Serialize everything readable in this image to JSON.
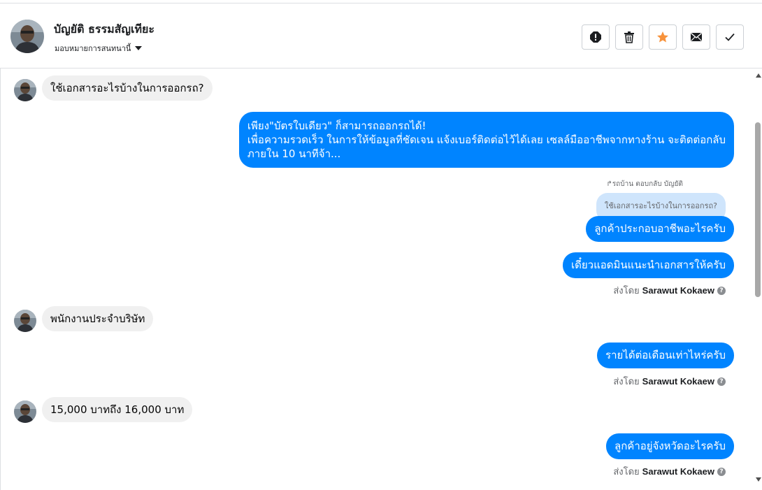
{
  "header": {
    "customer_name": "บัญยัติ ธรรมสัญเทียะ",
    "assign_label": "มอบหมายการสนทนานี้",
    "actions": [
      {
        "name": "spam-button",
        "icon": "alert-icon"
      },
      {
        "name": "delete-button",
        "icon": "trash-icon"
      },
      {
        "name": "star-button",
        "icon": "star-icon"
      },
      {
        "name": "mark-unread-button",
        "icon": "envelope-icon"
      },
      {
        "name": "mark-done-button",
        "icon": "check-icon"
      }
    ]
  },
  "colors": {
    "outgoing_bubble": "#0084ff",
    "incoming_bubble": "#f0f0f0",
    "star": "#f7923b",
    "quote_bubble": "#cfe5fc"
  },
  "messages": {
    "m1": "ใช้เอกสารอะไรบ้างในการออกรถ?",
    "m2_line1": "เพียง\"บัตรใบเดียว\" ก็สามารถออกรถได้!",
    "m2_line2": "เพื่อความรวดเร็ว ในการให้ข้อมูลที่ชัดเจน แจ้งเบอร์ติดต่อไว้ได้เลย เซลล์มืออาชีพจากทางร้าน จะติดต่อกลับ",
    "m2_line3": "ภายใน 10 นาทีจ้า...",
    "reply_meta": "รถบ้าน ตอบกลับ บัญยัติ",
    "reply_quote": "ใช้เอกสารอะไรบ้างในการออกรถ?",
    "m3": "ลูกค้าประกอบอาชีพอะไรครับ",
    "m4": "เดี๋ยวแอดมินแนะนำเอกสารให้ครับ",
    "m5": "พนักงานประจำบริษัท",
    "m6": "รายได้ต่อเดือนเท่าไหร่ครับ",
    "m7": "15,000 บาทถึง 16,000 บาท",
    "m8": "ลูกค้าอยู่จังหวัดอะไรครับ"
  },
  "sent_by": {
    "prefix": "ส่งโดย",
    "agent": "Sarawut Kokaew",
    "help": "?"
  }
}
